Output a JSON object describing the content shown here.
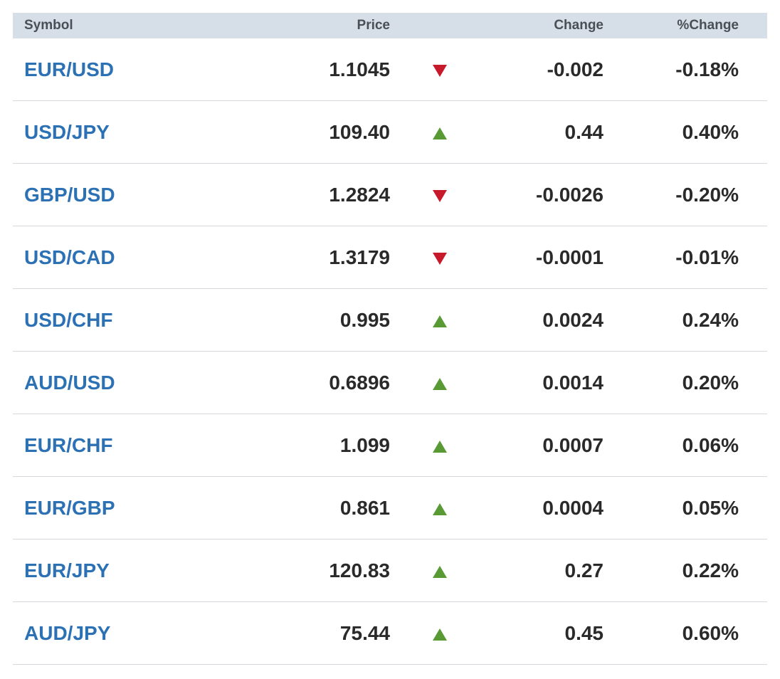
{
  "header": {
    "symbol": "Symbol",
    "price": "Price",
    "change": "Change",
    "pct_change": "%Change"
  },
  "colors": {
    "up": "#5a9a35",
    "down": "#c8192a",
    "link": "#2b71b3",
    "header_bg": "#d6dfe8"
  },
  "rows": [
    {
      "symbol": "EUR/USD",
      "price": "1.1045",
      "direction": "down",
      "change": "-0.002",
      "pct_change": "-0.18%"
    },
    {
      "symbol": "USD/JPY",
      "price": "109.40",
      "direction": "up",
      "change": "0.44",
      "pct_change": "0.40%"
    },
    {
      "symbol": "GBP/USD",
      "price": "1.2824",
      "direction": "down",
      "change": "-0.0026",
      "pct_change": "-0.20%"
    },
    {
      "symbol": "USD/CAD",
      "price": "1.3179",
      "direction": "down",
      "change": "-0.0001",
      "pct_change": "-0.01%"
    },
    {
      "symbol": "USD/CHF",
      "price": "0.995",
      "direction": "up",
      "change": "0.0024",
      "pct_change": "0.24%"
    },
    {
      "symbol": "AUD/USD",
      "price": "0.6896",
      "direction": "up",
      "change": "0.0014",
      "pct_change": "0.20%"
    },
    {
      "symbol": "EUR/CHF",
      "price": "1.099",
      "direction": "up",
      "change": "0.0007",
      "pct_change": "0.06%"
    },
    {
      "symbol": "EUR/GBP",
      "price": "0.861",
      "direction": "up",
      "change": "0.0004",
      "pct_change": "0.05%"
    },
    {
      "symbol": "EUR/JPY",
      "price": "120.83",
      "direction": "up",
      "change": "0.27",
      "pct_change": "0.22%"
    },
    {
      "symbol": "AUD/JPY",
      "price": "75.44",
      "direction": "up",
      "change": "0.45",
      "pct_change": "0.60%"
    }
  ]
}
